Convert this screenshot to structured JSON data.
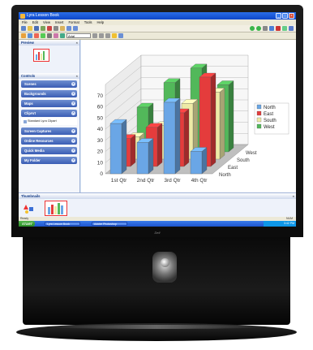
{
  "window": {
    "title": "Lyra Lesson Book"
  },
  "menu": [
    "File",
    "Edit",
    "View",
    "Insert",
    "Format",
    "Tools",
    "Help"
  ],
  "font_box": "Arial",
  "panels": {
    "preview": "Preview",
    "controls": "Controls",
    "thumbnails": "Thumbnails"
  },
  "controls": [
    {
      "label": "Scenes"
    },
    {
      "label": "Backgrounds"
    },
    {
      "label": "Maps"
    },
    {
      "label": "ClipArt"
    },
    {
      "label": "Screen Captures"
    },
    {
      "label": "Online Resources"
    },
    {
      "label": "Quick Media"
    },
    {
      "label": "My Folder"
    }
  ],
  "clipart_sub": "Standard Lyra Clipart",
  "chart_data": {
    "type": "bar",
    "subtype": "3d-clustered",
    "categories": [
      "1st Qtr",
      "2nd Qtr",
      "3rd Qtr",
      "4th Qtr"
    ],
    "series": [
      {
        "name": "North",
        "values": [
          45,
          28,
          64,
          20
        ],
        "color": "#6aa6e6"
      },
      {
        "name": "East",
        "values": [
          25,
          35,
          48,
          80
        ],
        "color": "#e43c3c"
      },
      {
        "name": "South",
        "values": [
          20,
          30,
          50,
          60
        ],
        "color": "#eeeaa6"
      },
      {
        "name": "West",
        "values": [
          40,
          62,
          75,
          60
        ],
        "color": "#52b85a"
      }
    ],
    "yticks": [
      "0",
      "10",
      "20",
      "30",
      "40",
      "50",
      "60",
      "70"
    ],
    "depth_labels": [
      "North",
      "East",
      "South",
      "West"
    ],
    "ylim": [
      0,
      80
    ],
    "legend_position": "right"
  },
  "statusbar": {
    "left": "Ready",
    "right": "NUM"
  },
  "taskbar": {
    "start": "START",
    "tasks": [
      "Lyra Lesson Book",
      "Adobe Photoshop"
    ],
    "tray": "3:42 PM"
  }
}
